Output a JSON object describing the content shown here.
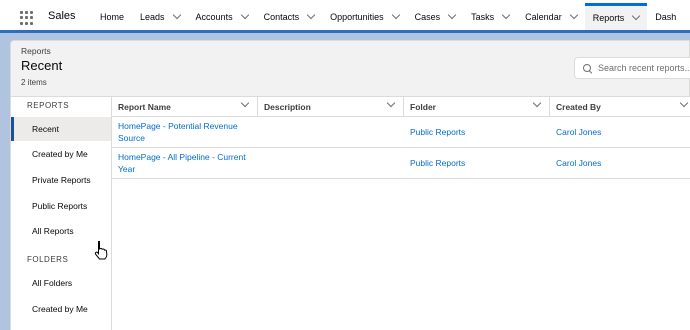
{
  "app": {
    "name": "Sales"
  },
  "nav": {
    "tabs": [
      {
        "label": "Home",
        "has_menu": false
      },
      {
        "label": "Leads",
        "has_menu": true
      },
      {
        "label": "Accounts",
        "has_menu": true
      },
      {
        "label": "Contacts",
        "has_menu": true
      },
      {
        "label": "Opportunities",
        "has_menu": true
      },
      {
        "label": "Cases",
        "has_menu": true
      },
      {
        "label": "Tasks",
        "has_menu": true
      },
      {
        "label": "Calendar",
        "has_menu": true
      },
      {
        "label": "Reports",
        "has_menu": true,
        "active": true
      },
      {
        "label": "Dash",
        "has_menu": false
      }
    ]
  },
  "header": {
    "breadcrumb": "Reports",
    "title": "Recent",
    "count": "2 items",
    "search_placeholder": "Search recent reports..."
  },
  "sidebar": {
    "reports_label": "REPORTS",
    "report_items": [
      "Recent",
      "Created by Me",
      "Private Reports",
      "Public Reports",
      "All Reports"
    ],
    "folders_label": "FOLDERS",
    "folder_items": [
      "All Folders",
      "Created by Me"
    ]
  },
  "table": {
    "columns": [
      "Report Name",
      "Description",
      "Folder",
      "Created By"
    ],
    "rows": [
      {
        "name": "HomePage - Potential Revenue Source",
        "description": "",
        "folder": "Public Reports",
        "created_by": "Carol Jones"
      },
      {
        "name": "HomePage - All Pipeline - Current Year",
        "description": "",
        "folder": "Public Reports",
        "created_by": "Carol Jones"
      }
    ]
  },
  "colors": {
    "brand": "#0070d2",
    "link": "#006dcc",
    "active_marker": "#1b5297"
  }
}
